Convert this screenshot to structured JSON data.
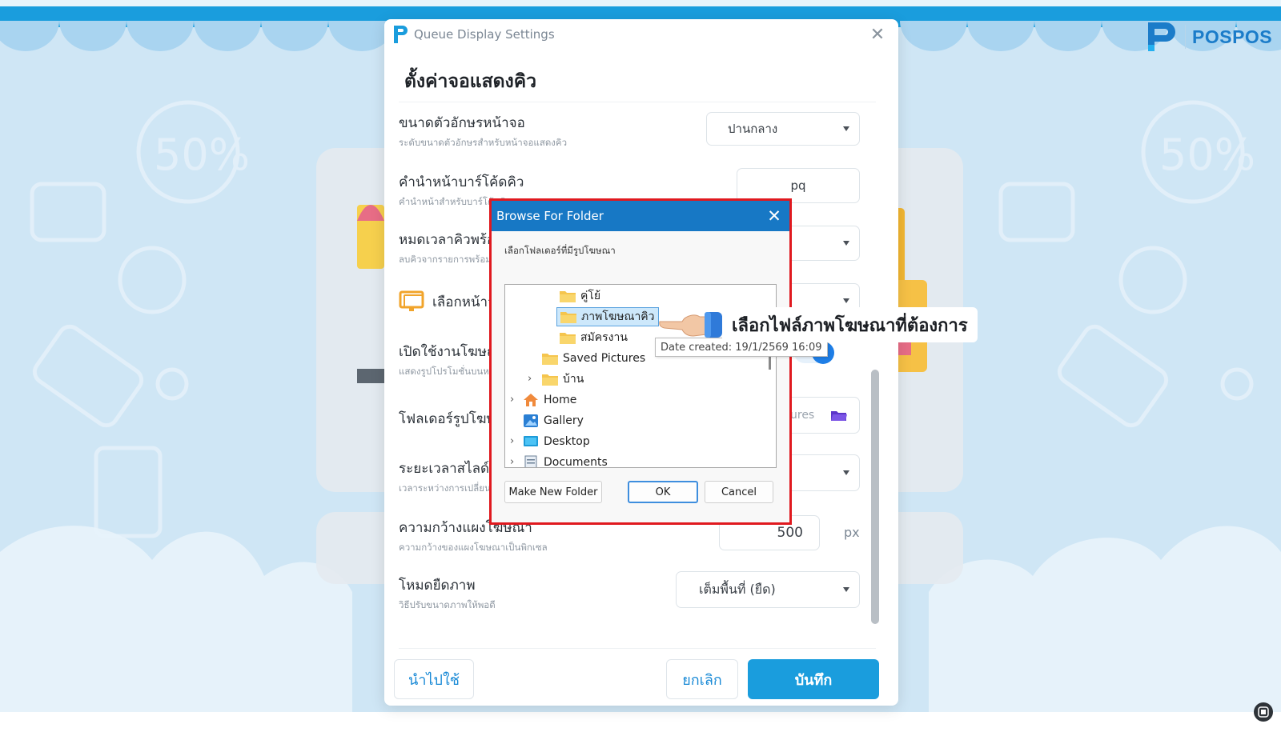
{
  "brand": {
    "name": "POSPOS"
  },
  "settings_dialog": {
    "window_title": "Queue Display Settings",
    "heading": "ตั้งค่าจอแสดงคิว",
    "rows": {
      "font_size": {
        "label": "ขนาดตัวอักษรหน้าจอ",
        "desc": "ระดับขนาดตัวอักษรสำหรับหน้าจอแสดงคิว",
        "value": "ปานกลาง"
      },
      "barcode_prefix": {
        "label": "คำนำหน้าบาร์โค้ดคิว",
        "desc": "คำนำหน้าสำหรับบาร์โค้ดคิว",
        "value": "pq"
      },
      "timeout": {
        "label": "หมดเวลาคิวพร้อม",
        "desc": "ลบคิวจากรายการพร้อมรับ"
      },
      "select_display": {
        "label": "เลือกหน้าจอแสดงผล"
      },
      "enable_ads": {
        "label": "เปิดใช้งานโฆษณา",
        "desc": "แสดงรูปโปรโมชั่นบนหน้าจอ",
        "on": true
      },
      "ad_folder": {
        "label": "โฟลเดอร์รูปโฆษณา",
        "value": "ures"
      },
      "slide_interval": {
        "label": "ระยะเวลาสไลด์",
        "desc": "เวลาระหว่างการเปลี่ยนภาพ"
      },
      "ad_width": {
        "label": "ความกว้างแผงโฆษณา",
        "desc": "ความกว้างของแผงโฆษณาเป็นพิกเซล",
        "value": "500",
        "unit": "px"
      },
      "stretch_mode": {
        "label": "โหมดยืดภาพ",
        "desc": "วิธีปรับขนาดภาพให้พอดี",
        "value": "เต็มพื้นที่ (ยืด)"
      }
    },
    "buttons": {
      "apply": "นำไปใช้",
      "cancel": "ยกเลิก",
      "save": "บันทึก"
    }
  },
  "browse_dialog": {
    "title": "Browse For Folder",
    "instruction": "เลือกโฟลเดอร์ที่มีรูปโฆษณา",
    "tree": [
      {
        "label": "คู่โย้",
        "icon": "folder-icon"
      },
      {
        "label": "ภาพโฆษณาคิว",
        "icon": "folder-icon",
        "selected": true
      },
      {
        "label": "สมัครงาน",
        "icon": "folder-icon"
      },
      {
        "label": "Saved Pictures",
        "icon": "folder-icon"
      },
      {
        "label": "บ้าน",
        "icon": "folder-icon",
        "expandable": true
      },
      {
        "label": "Home",
        "icon": "home-icon",
        "expandable": true
      },
      {
        "label": "Gallery",
        "icon": "gallery-icon"
      },
      {
        "label": "Desktop",
        "icon": "desktop-icon",
        "expandable": true
      },
      {
        "label": "Documents",
        "icon": "documents-icon",
        "expandable": true
      }
    ],
    "buttons": {
      "new_folder": "Make New Folder",
      "ok": "OK",
      "cancel": "Cancel"
    },
    "tooltip": "Date created: 19/1/2569 16:09"
  },
  "annotation": {
    "callout": "เลือกไฟล์ภาพโฆษณาที่ต้องการ"
  },
  "colors": {
    "accent": "#1a9ddd",
    "highlight_border": "#e0191f",
    "dialog_title": "#1778c5",
    "toggle_on": "#1e7ee6"
  }
}
